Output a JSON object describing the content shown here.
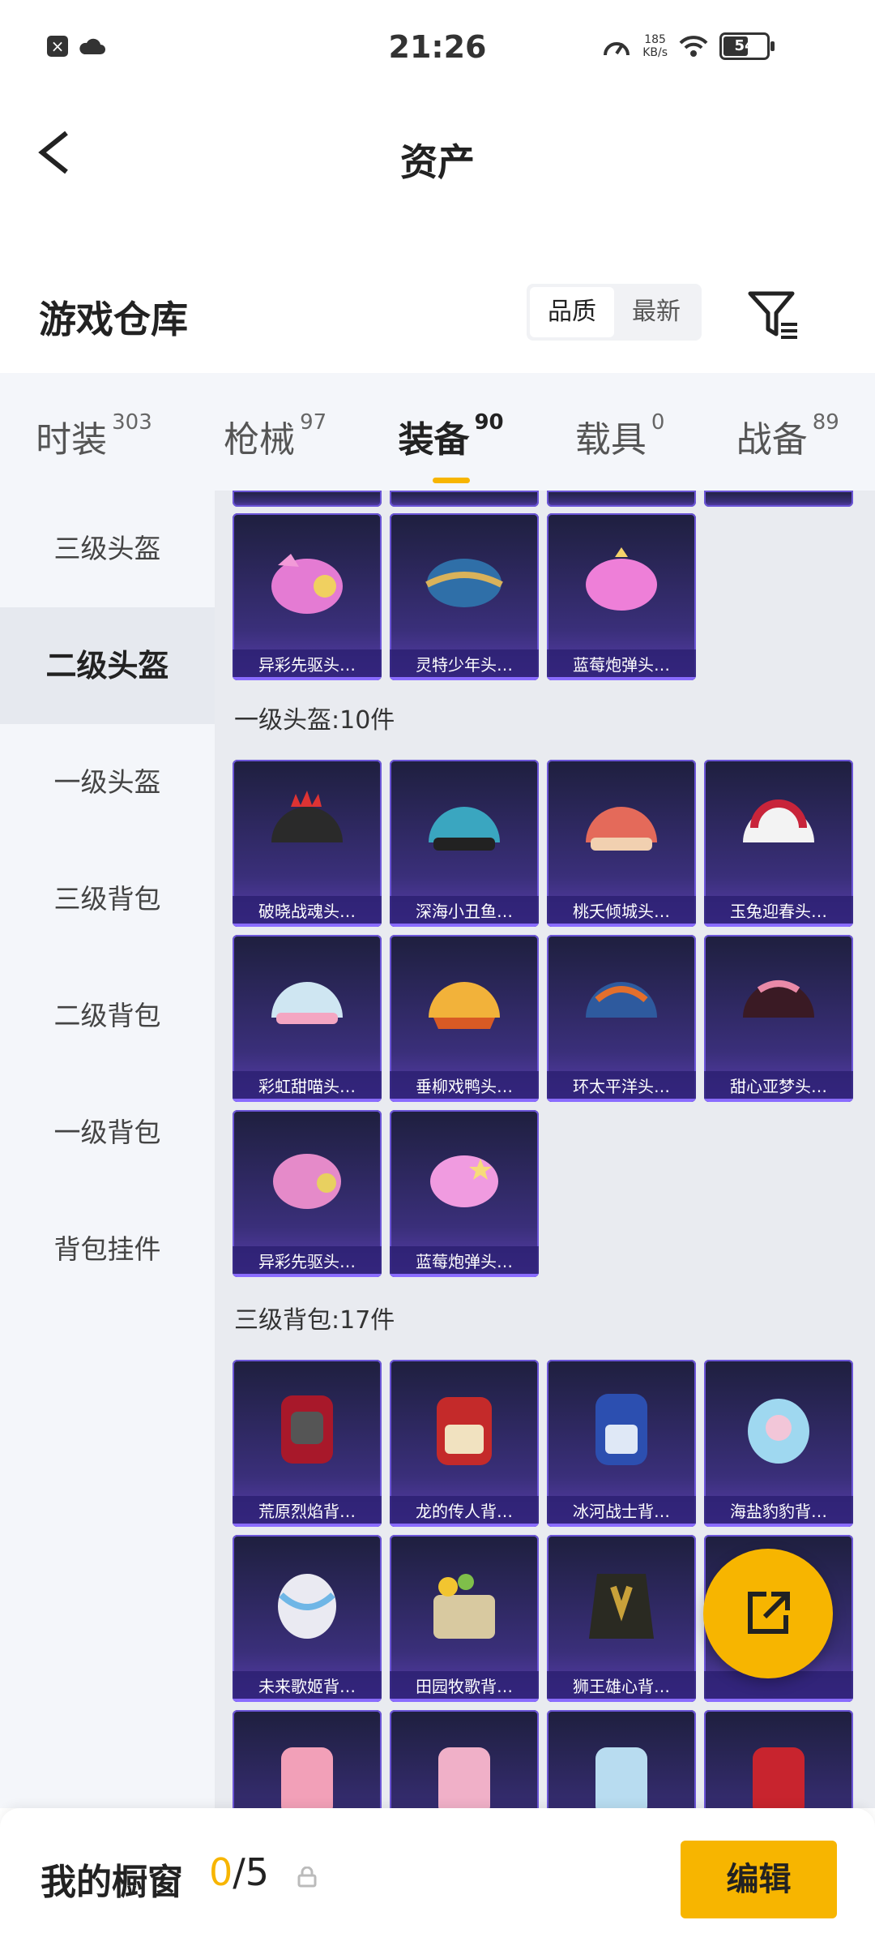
{
  "status_bar": {
    "time": "21:26",
    "speed_value": "185",
    "speed_unit": "KB/s",
    "battery": "54"
  },
  "header": {
    "title": "资产"
  },
  "warehouse": {
    "title": "游戏仓库",
    "sort_options": [
      "品质",
      "最新"
    ],
    "active_sort": "品质"
  },
  "tabs": [
    {
      "label": "时装",
      "count": "303"
    },
    {
      "label": "枪械",
      "count": "97"
    },
    {
      "label": "装备",
      "count": "90"
    },
    {
      "label": "载具",
      "count": "0"
    },
    {
      "label": "战备",
      "count": "89"
    }
  ],
  "sidebar": {
    "items": [
      "三级头盔",
      "二级头盔",
      "一级头盔",
      "三级背包",
      "二级背包",
      "一级背包",
      "背包挂件"
    ],
    "active": "二级头盔"
  },
  "groups": {
    "level2_helmet": {
      "items": [
        "异彩先驱头…",
        "灵特少年头…",
        "蓝莓炮弹头…"
      ]
    },
    "level1_helmet": {
      "title": "一级头盔:10件",
      "items": [
        "破晓战魂头…",
        "深海小丑鱼…",
        "桃夭倾城头…",
        "玉兔迎春头…",
        "彩虹甜喵头…",
        "垂柳戏鸭头…",
        "环太平洋头…",
        "甜心亚梦头…",
        "异彩先驱头…",
        "蓝莓炮弹头…"
      ]
    },
    "level3_backpack": {
      "title": "三级背包:17件",
      "items": [
        "荒原烈焰背…",
        "龙的传人背…",
        "冰河战士背…",
        "海盐豹豹背…",
        "未来歌姬背…",
        "田园牧歌背…",
        "狮王雄心背…",
        "",
        "",
        "",
        "",
        ""
      ]
    }
  },
  "bottom_bar": {
    "title": "我的橱窗",
    "count_current": "0",
    "count_total": "/5",
    "edit_label": "编辑"
  },
  "colors": {
    "accent": "#f7b500",
    "card_bg": "#3a2f7a"
  }
}
